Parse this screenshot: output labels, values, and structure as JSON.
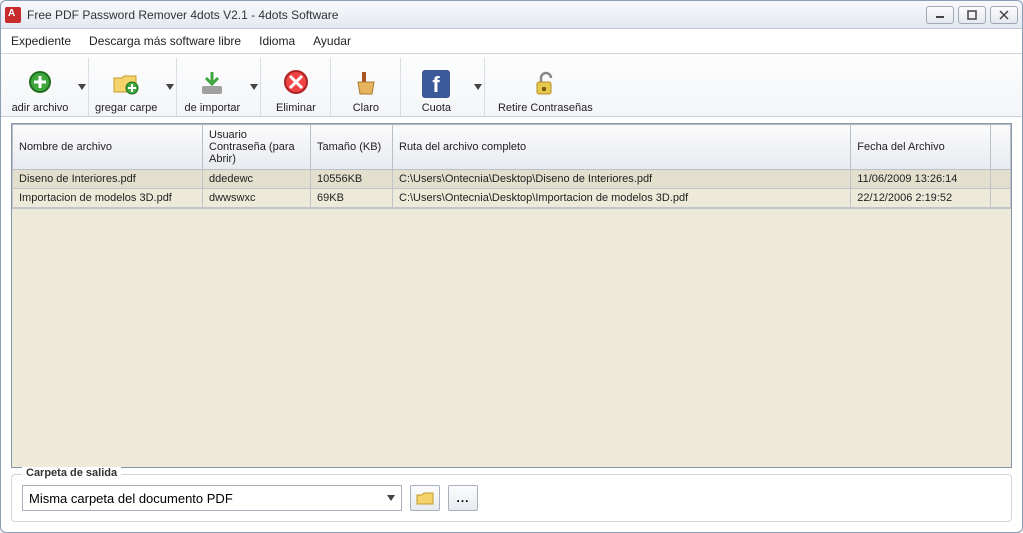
{
  "window": {
    "title": "Free PDF Password Remover 4dots V2.1 - 4dots Software"
  },
  "menu": {
    "items": [
      "Expediente",
      "Descarga más software libre",
      "Idioma",
      "Ayudar"
    ]
  },
  "toolbar": {
    "add_file": "adir archivo",
    "add_folder": "gregar carpe",
    "import": "de importar",
    "remove": "Eliminar",
    "clear": "Claro",
    "share": "Cuota",
    "unlock": "Retire Contraseñas"
  },
  "table": {
    "headers": {
      "filename": "Nombre de archivo",
      "password": "Usuario Contraseña (para Abrir)",
      "size": "Tamaño (KB)",
      "path": "Ruta del archivo completo",
      "date": "Fecha del Archivo"
    },
    "rows": [
      {
        "filename": "Diseno de Interiores.pdf",
        "password": "ddedewc",
        "size": "10556KB",
        "path": "C:\\Users\\Ontecnia\\Desktop\\Diseno de Interiores.pdf",
        "date": "11/06/2009 13:26:14"
      },
      {
        "filename": "Importacion de modelos 3D.pdf",
        "password": "dwwswxc",
        "size": "69KB",
        "path": "C:\\Users\\Ontecnia\\Desktop\\Importacion de modelos 3D.pdf",
        "date": "22/12/2006 2:19:52"
      }
    ]
  },
  "output": {
    "legend": "Carpeta de salida",
    "value": "Misma carpeta del documento PDF"
  }
}
